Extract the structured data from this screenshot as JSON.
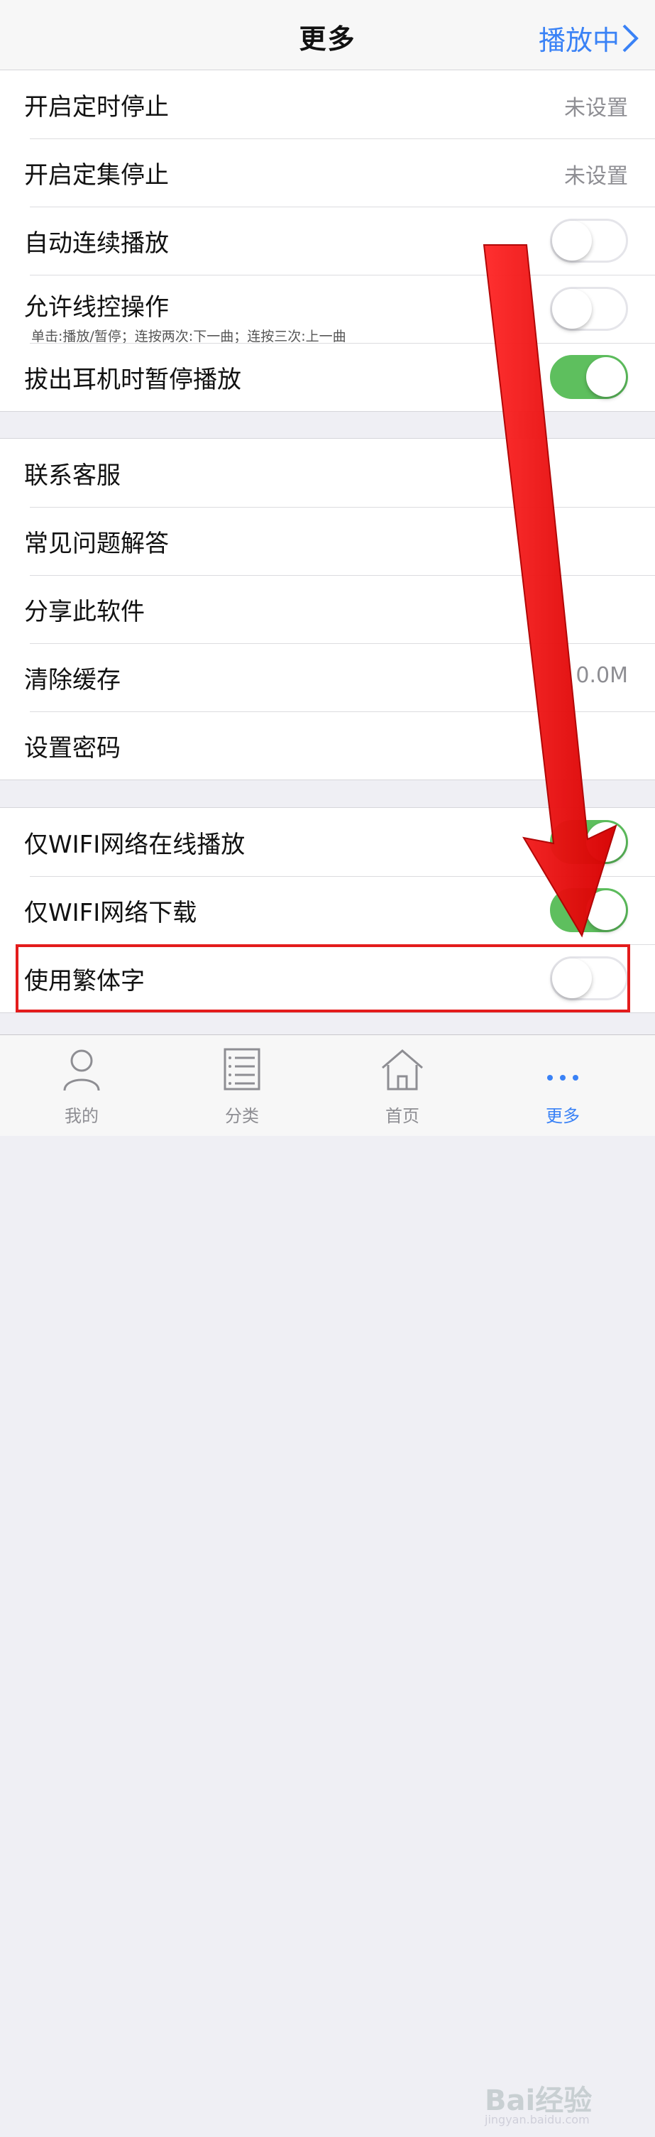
{
  "nav": {
    "title": "更多",
    "right_label": "播放中"
  },
  "groups": [
    {
      "rows": [
        {
          "label": "开启定时停止",
          "value": "未设置"
        },
        {
          "label": "开启定集停止",
          "value": "未设置"
        },
        {
          "label": "自动连续播放",
          "switch": "off"
        },
        {
          "label": "允许线控操作",
          "sub": "单击:播放/暂停；连按两次:下一曲；连按三次:上一曲",
          "switch": "off"
        },
        {
          "label": "拔出耳机时暂停播放",
          "switch": "on"
        }
      ]
    },
    {
      "rows": [
        {
          "label": "联系客服"
        },
        {
          "label": "常见问题解答"
        },
        {
          "label": "分享此软件"
        },
        {
          "label": "清除缓存",
          "value": "0.0M"
        },
        {
          "label": "设置密码"
        }
      ]
    },
    {
      "rows": [
        {
          "label": "仅WIFI网络在线播放",
          "switch": "on"
        },
        {
          "label": "仅WIFI网络下载",
          "switch": "on"
        },
        {
          "label": "使用繁体字",
          "switch": "off"
        }
      ]
    }
  ],
  "tabs": [
    {
      "label": "我的",
      "icon": "person-icon"
    },
    {
      "label": "分类",
      "icon": "list-icon"
    },
    {
      "label": "首页",
      "icon": "home-icon"
    },
    {
      "label": "更多",
      "icon": "more-icon",
      "active": true
    }
  ],
  "watermark": {
    "text": "Bai经验",
    "url": "jingyan.baidu.com"
  },
  "colors": {
    "accent": "#3a82f6",
    "switch_on": "#5ebf5e",
    "annotation": "#e31c1c"
  }
}
